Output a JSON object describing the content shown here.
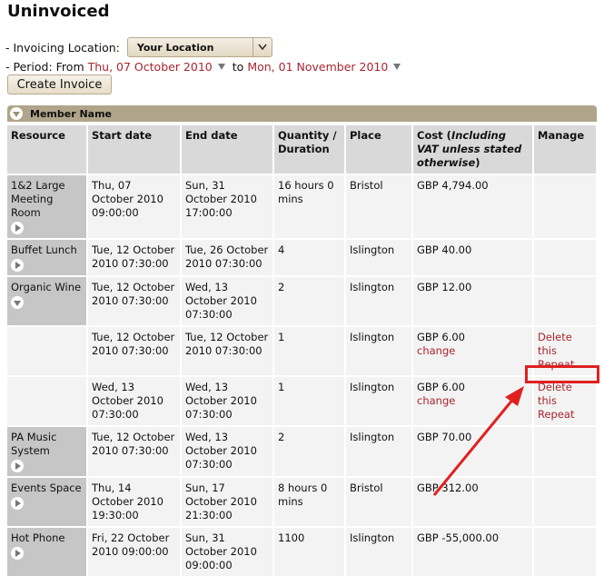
{
  "page": {
    "title": "Uninvoiced"
  },
  "filters": {
    "location_label": "- Invoicing Location:",
    "location_value": "Your Location",
    "period_label": "- Period: From",
    "period_from": "Thu, 07 October 2010",
    "period_to_label": "to",
    "period_to": "Mon, 01 November 2010"
  },
  "actions": {
    "create_invoice": "Create Invoice"
  },
  "group": {
    "label": "Member Name"
  },
  "table": {
    "headers": [
      "Resource",
      "Start date",
      "End date",
      "Quantity / Duration",
      "Place",
      "Cost (Including VAT unless stated otherwise)",
      "Manage"
    ],
    "header_cost_main": "Cost (",
    "header_cost_em": "Including VAT unless stated otherwise",
    "header_cost_tail": ")",
    "rows": [
      {
        "resource": "1&2 Large Meeting Room",
        "start": "Thu, 07 October 2010 09:00:00",
        "end": "Sun, 31 October 2010 17:00:00",
        "qty": "16 hours 0 mins",
        "place": "Bristol",
        "cost": "GBP 4,794.00"
      },
      {
        "resource": "Buffet Lunch",
        "start": "Tue, 12 October 2010 07:30:00",
        "end": "Tue, 26 October 2010 07:30:00",
        "qty": "4",
        "place": "Islington",
        "cost": "GBP 40.00"
      },
      {
        "resource": "Organic Wine",
        "start": "Tue, 12 October 2010 07:30:00",
        "end": "Wed, 13 October 2010 07:30:00",
        "qty": "2",
        "place": "Islington",
        "cost": "GBP 12.00"
      },
      {
        "resource": "",
        "start": "Tue, 12 October 2010 07:30:00",
        "end": "Tue, 12 October 2010 07:30:00",
        "qty": "1",
        "place": "Islington",
        "cost": "GBP 6.00",
        "change": "change",
        "manage": "Delete this Repeat"
      },
      {
        "resource": "",
        "start": "Wed, 13 October 2010 07:30:00",
        "end": "Wed, 13 October 2010 07:30:00",
        "qty": "1",
        "place": "Islington",
        "cost": "GBP 6.00",
        "change": "change",
        "manage": "Delete this Repeat"
      },
      {
        "resource": "PA Music System",
        "start": "Tue, 12 October 2010 07:30:00",
        "end": "Wed, 13 October 2010 07:30:00",
        "qty": "2",
        "place": "Islington",
        "cost": "GBP 70.00"
      },
      {
        "resource": "Events Space",
        "start": "Thu, 14 October 2010 19:30:00",
        "end": "Sun, 17 October 2010 21:30:00",
        "qty": "8 hours 0 mins",
        "place": "Bristol",
        "cost": "GBP 312.00"
      },
      {
        "resource": "Hot Phone",
        "start": "Fri, 22 October 2010 09:00:00",
        "end": "Sun, 31 October 2010 09:00:00",
        "qty": "1100",
        "place": "Islington",
        "cost": "GBP -55,000.00"
      }
    ]
  },
  "colors": {
    "accent_red": "#a8262f",
    "header_tan": "#b0a58b",
    "annotation_red": "#e02020"
  }
}
